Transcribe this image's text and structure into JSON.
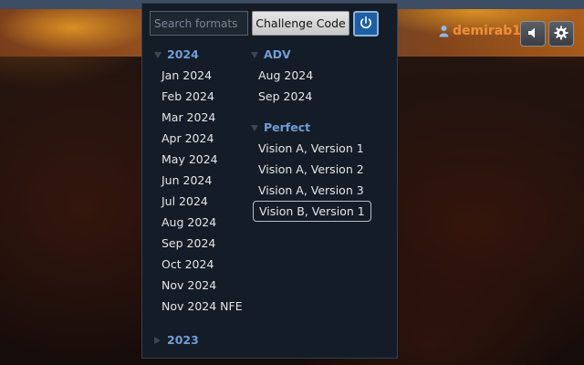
{
  "header": {
    "username": "demirab1",
    "icons": [
      "user-icon",
      "sound-icon",
      "gear-icon"
    ]
  },
  "dropdown": {
    "search_placeholder": "Search formats",
    "challenge_code_label": "Challenge Code",
    "power_icon": "power-icon",
    "groups_left": [
      {
        "label": "2024",
        "expanded": true,
        "items": [
          "Jan 2024",
          "Feb 2024",
          "Mar 2024",
          "Apr 2024",
          "May 2024",
          "Jun 2024",
          "Jul 2024",
          "Aug 2024",
          "Sep 2024",
          "Oct 2024",
          "Nov 2024",
          "Nov 2024 NFE"
        ]
      },
      {
        "label": "2023",
        "expanded": false,
        "items": []
      }
    ],
    "groups_right": [
      {
        "label": "ADV",
        "expanded": true,
        "items": [
          "Aug 2024",
          "Sep 2024"
        ]
      },
      {
        "label": "Perfect",
        "expanded": true,
        "items": [
          "Vision A, Version 1",
          "Vision A, Version 2",
          "Vision A, Version 3",
          "Vision B, Version 1"
        ],
        "selected": "Vision B, Version 1"
      }
    ]
  },
  "colors": {
    "accent_blue": "#1d5fa3",
    "group_label": "#6f9ed6",
    "username": "#f0903a",
    "panel_bg": "#141c27"
  }
}
